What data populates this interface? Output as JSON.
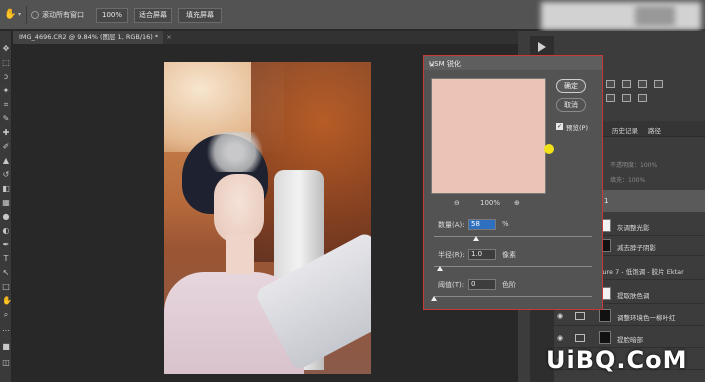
{
  "options_bar": {
    "tool_icon": "hand-icon",
    "scroll_all_windows_label": "滚动所有窗口",
    "zoom_100_label": "100%",
    "fit_screen_label": "适合屏幕",
    "fill_screen_label": "填充屏幕"
  },
  "document_tab": {
    "title": "IMG_4696.CR2 @ 9.84% (图层 1, RGB/16) *",
    "close": "×"
  },
  "usm_dialog": {
    "title": "USM 锐化",
    "close": "×",
    "ok_label": "确定",
    "cancel_label": "取消",
    "preview_label": "预览(P)",
    "preview_checked": true,
    "zoom_value": "100%",
    "zoom_out": "⊖",
    "zoom_in": "⊕",
    "amount_label": "数量(A):",
    "amount_value": "58",
    "amount_unit": "%",
    "radius_label": "半径(R):",
    "radius_value": "1.0",
    "radius_unit": "像素",
    "threshold_label": "阈值(T):",
    "threshold_value": "0",
    "threshold_unit": "色阶"
  },
  "panels": {
    "history_tab": "历史记录",
    "paths_tab": "路径",
    "opacity_label": "不透明度：100%",
    "fill_label": "填充：100%",
    "selected_layer_name": "1"
  },
  "layers": [
    {
      "name": "灰调整光影",
      "thumb": "light"
    },
    {
      "name": "减去脖子阴影",
      "thumb": "dark"
    },
    {
      "name": "osure 7 - 低饱调 - 胶片 Ektar",
      "thumb": "none"
    },
    {
      "name": "提取肤色调",
      "thumb": "light"
    },
    {
      "name": "调整环境色一柳叶红",
      "thumb": "dark"
    },
    {
      "name": "提脸暗部",
      "thumb": "dark"
    }
  ],
  "watermark": "UiBQ.CoM"
}
